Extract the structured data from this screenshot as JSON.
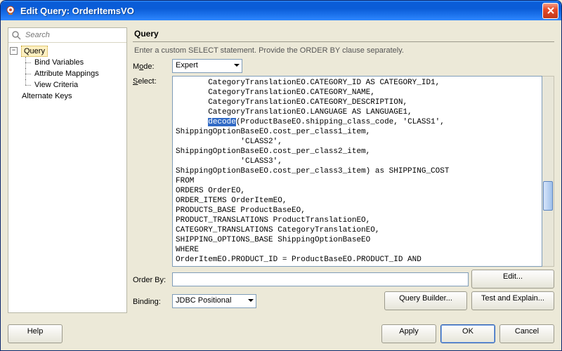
{
  "window": {
    "title": "Edit Query: OrderItemsVO"
  },
  "search": {
    "placeholder": "Search"
  },
  "tree": {
    "root_label": "Query",
    "children": [
      {
        "label": "Bind Variables"
      },
      {
        "label": "Attribute Mappings"
      },
      {
        "label": "View Criteria"
      }
    ],
    "alt_label": "Alternate Keys"
  },
  "panel": {
    "header": "Query",
    "description": "Enter a custom SELECT statement. Provide the ORDER BY clause separately.",
    "mode_label_pre": "M",
    "mode_label_u": "o",
    "mode_label_post": "de:",
    "mode_value": "Expert",
    "select_label_u": "S",
    "select_label_post": "elect:",
    "orderby_label": "Order By:",
    "orderby_value": "",
    "binding_label": "Binding:",
    "binding_value": "JDBC Positional"
  },
  "code": {
    "pre1": "       CategoryTranslationEO.CATEGORY_ID AS CATEGORY_ID1,\n       CategoryTranslationEO.CATEGORY_NAME,\n       CategoryTranslationEO.CATEGORY_DESCRIPTION,\n       CategoryTranslationEO.LANGUAGE AS LANGUAGE1,\n       ",
    "decode": "decode",
    "post1": "(ProductBaseEO.shipping_class_code, 'CLASS1',\nShippingOptionBaseEO.cost_per_class1_item,\n              'CLASS2',\nShippingOptionBaseEO.cost_per_class2_item,\n              'CLASS3',\nShippingOptionBaseEO.cost_per_class3_item) as SHIPPING_COST\nFROM\nORDERS OrderEO,\nORDER_ITEMS OrderItemEO,\nPRODUCTS_BASE ProductBaseEO,\nPRODUCT_TRANSLATIONS ProductTranslationEO,\nCATEGORY_TRANSLATIONS CategoryTranslationEO,\nSHIPPING_OPTIONS_BASE ShippingOptionBaseEO\nWHERE\nOrderItemEO.PRODUCT_ID = ProductBaseEO.PRODUCT_ID AND"
  },
  "buttons": {
    "edit": "Edit...",
    "query_builder": "Query Builder...",
    "test_explain": "Test and Explain...",
    "help": "Help",
    "apply": "Apply",
    "ok": "OK",
    "cancel": "Cancel"
  }
}
